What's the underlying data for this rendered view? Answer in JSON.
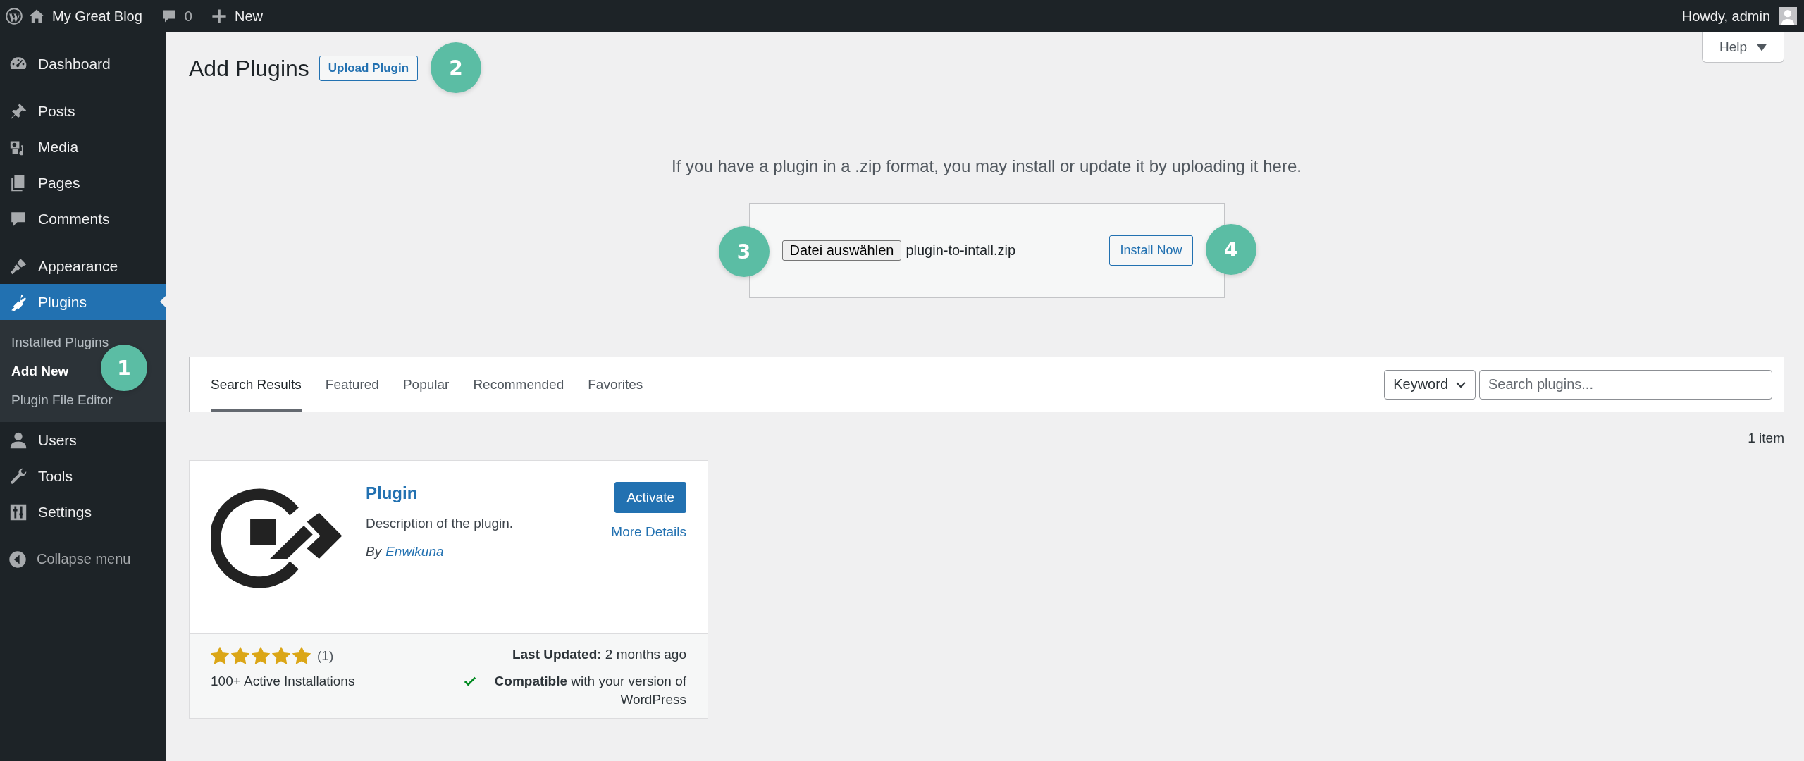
{
  "admin_bar": {
    "site_name": "My Great Blog",
    "comments_count": "0",
    "new_label": "New",
    "greeting": "Howdy, admin"
  },
  "sidebar": {
    "groups": [
      {
        "items": [
          {
            "label": "Dashboard",
            "kind": "dashboard",
            "selected": false
          }
        ]
      },
      {
        "items": [
          {
            "label": "Posts",
            "kind": "posts",
            "selected": false
          },
          {
            "label": "Media",
            "kind": "media",
            "selected": false
          },
          {
            "label": "Pages",
            "kind": "pages",
            "selected": false
          },
          {
            "label": "Comments",
            "kind": "comments",
            "selected": false
          }
        ]
      },
      {
        "items": [
          {
            "label": "Appearance",
            "kind": "appearance",
            "selected": false
          },
          {
            "label": "Plugins",
            "kind": "plugins",
            "selected": true,
            "children": [
              {
                "label": "Installed Plugins",
                "selected": false
              },
              {
                "label": "Add New",
                "selected": true
              },
              {
                "label": "Plugin File Editor",
                "selected": false
              }
            ]
          },
          {
            "label": "Users",
            "kind": "users",
            "selected": false
          },
          {
            "label": "Tools",
            "kind": "tools",
            "selected": false
          },
          {
            "label": "Settings",
            "kind": "settings",
            "selected": false
          }
        ]
      }
    ],
    "collapse_label": "Collapse menu"
  },
  "help_tab": {
    "label": "Help"
  },
  "page": {
    "title": "Add Plugins",
    "upload_button": "Upload Plugin"
  },
  "upload": {
    "message": "If you have a plugin in a .zip format, you may install or update it by uploading it here.",
    "file_button": "Datei auswählen",
    "file_name": "plugin-to-intall.zip",
    "install_button": "Install Now"
  },
  "filter": {
    "tabs": [
      {
        "label": "Search Results",
        "selected": true
      },
      {
        "label": "Featured",
        "selected": false
      },
      {
        "label": "Popular",
        "selected": false
      },
      {
        "label": "Recommended",
        "selected": false
      },
      {
        "label": "Favorites",
        "selected": false
      }
    ],
    "search_type": "Keyword",
    "search_placeholder": "Search plugins..."
  },
  "item_count": "1 item",
  "plugins": [
    {
      "name": "Plugin",
      "description": "Description of the plugin.",
      "author_prefix": "By",
      "author": "Enwikuna",
      "action": "Activate",
      "details_link": "More Details",
      "stars": 5,
      "rating_count": "(1)",
      "installs": "100+ Active Installations",
      "last_updated": "**Last Updated:** 2 months ago",
      "compatible": true,
      "compatibility": "**Compatible** with your version of WordPress"
    }
  ],
  "annotations": [
    {
      "label": "1"
    },
    {
      "label": "2"
    },
    {
      "label": "3"
    },
    {
      "label": "4"
    }
  ]
}
